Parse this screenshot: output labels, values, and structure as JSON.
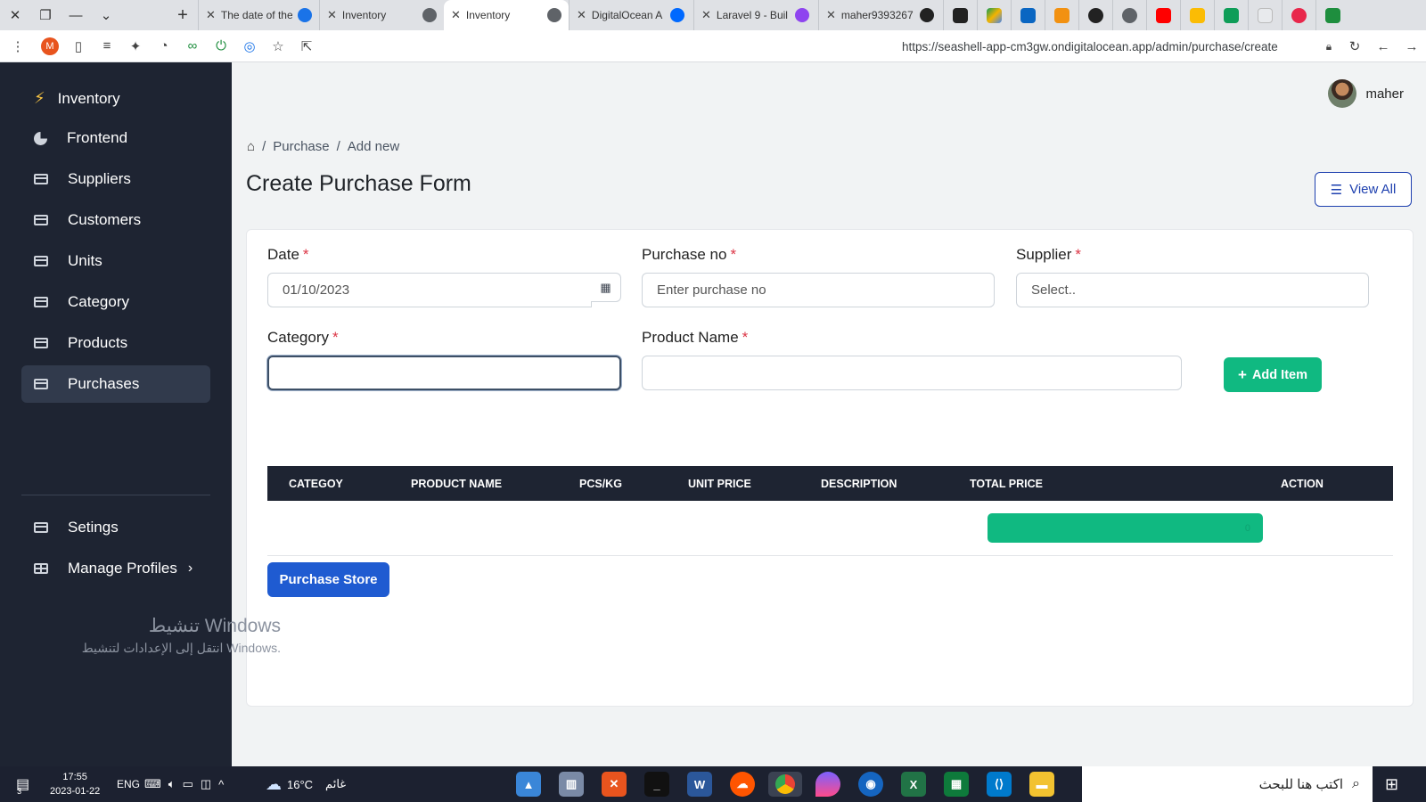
{
  "browser": {
    "tabs": [
      {
        "title": "The date of the",
        "active": false
      },
      {
        "title": "Inventory",
        "active": false
      },
      {
        "title": "Inventory",
        "active": true
      },
      {
        "title": "DigitalOcean A",
        "active": false
      },
      {
        "title": "Laravel 9 - Buil",
        "active": false
      },
      {
        "title": "maher9393267",
        "active": false
      }
    ],
    "extension_badge": "M",
    "url": "https://seashell-app-cm3gw.ondigitalocean.app/admin/purchase/create"
  },
  "sidebar": {
    "brand": "Inventory",
    "items": [
      {
        "label": "Frontend",
        "icon": "pie-chart-icon"
      },
      {
        "label": "Suppliers",
        "icon": "card-icon"
      },
      {
        "label": "Customers",
        "icon": "card-icon"
      },
      {
        "label": "Units",
        "icon": "card-icon"
      },
      {
        "label": "Category",
        "icon": "card-icon"
      },
      {
        "label": "Products",
        "icon": "card-icon"
      },
      {
        "label": "Purchases",
        "icon": "card-icon",
        "active": true
      }
    ],
    "bottom_items": [
      {
        "label": "Setings",
        "icon": "card-icon"
      },
      {
        "label": "Manage Profiles",
        "icon": "table-icon"
      }
    ]
  },
  "header": {
    "user_name": "maher"
  },
  "breadcrumb": [
    "Purchase",
    "Add new"
  ],
  "page": {
    "title": "Create Purchase Form",
    "view_all_label": "View All"
  },
  "form": {
    "date_label": "Date",
    "date_value": "01/10/2023",
    "purchase_no_label": "Purchase no",
    "purchase_no_placeholder": "Enter purchase no",
    "supplier_label": "Supplier",
    "supplier_value": "Select..",
    "category_label": "Category",
    "category_value": "",
    "product_label": "Product Name",
    "product_value": "",
    "required_mark": "*",
    "add_item_label": "Add Item"
  },
  "table": {
    "columns": [
      "CATEGOY",
      "PRODUCT NAME",
      "PCS/KG",
      "UNIT PRICE",
      "DESCRIPTION",
      "TOTAL PRICE",
      "ACTION"
    ],
    "total_value": "0"
  },
  "store_button_label": "Purchase Store",
  "watermark": {
    "line1": "تنشيط Windows",
    "line2": "انتقل إلى الإعدادات لتنشيط Windows."
  },
  "taskbar": {
    "notification_count": "3",
    "time": "17:55",
    "date": "2023-01-22",
    "language": "ENG",
    "temperature": "16°C",
    "weather_text": "غائم",
    "search_placeholder": "اكتب هنا للبحث"
  },
  "colors": {
    "sidebar_bg": "#1e2432",
    "accent_green": "#10b981",
    "accent_blue": "#1f5bd1",
    "required_red": "#dc3545"
  }
}
